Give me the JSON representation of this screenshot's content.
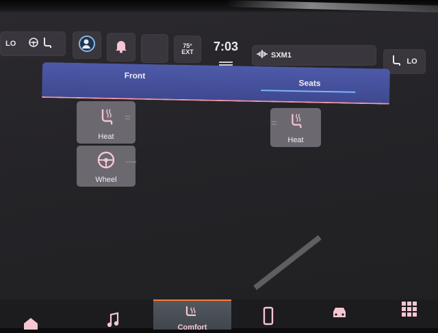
{
  "topbar": {
    "left_climate": {
      "level": "LO"
    },
    "outside_temp": {
      "value": "75°",
      "label": "EXT"
    },
    "time": "7:03",
    "media": {
      "source": "SXM1"
    },
    "right_climate": {
      "level": "LO"
    }
  },
  "panel": {
    "tabs": [
      {
        "label": "Front"
      },
      {
        "label": "Seats"
      }
    ],
    "selected_tab": "Seats"
  },
  "controls": {
    "driver_seat_heat": {
      "label": "Heat",
      "level": "="
    },
    "steering_wheel_heat": {
      "label": "Wheel",
      "level": "—"
    },
    "passenger_seat_heat": {
      "label": "Heat",
      "level": "="
    }
  },
  "navbar": {
    "items": [
      {
        "icon": "home-icon"
      },
      {
        "icon": "music-icon"
      },
      {
        "icon": "comfort-icon",
        "label": "Comfort",
        "active": true
      },
      {
        "icon": "phone-icon"
      },
      {
        "icon": "vehicle-icon"
      },
      {
        "icon": "apps-grid-icon"
      }
    ]
  },
  "colors": {
    "accent_icon": "#f6c6d2",
    "tab_bar": "#4d5aa8",
    "active_nav_border": "#ff7a3a"
  }
}
